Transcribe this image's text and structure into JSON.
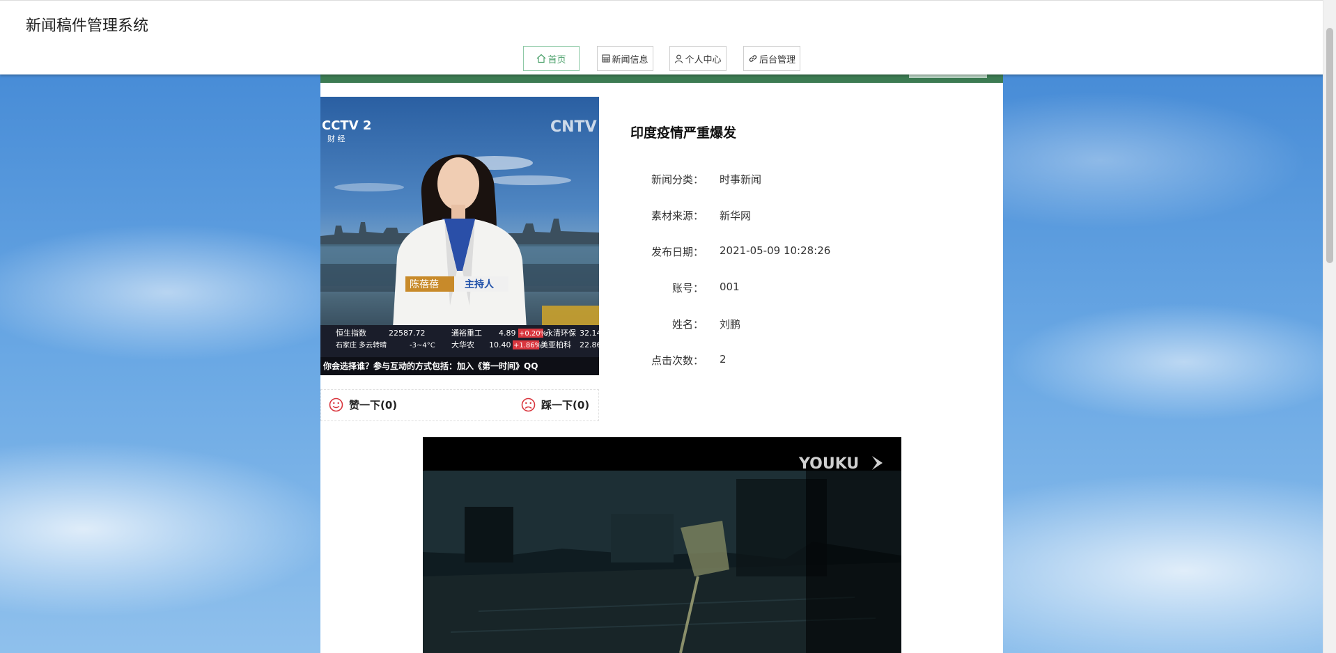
{
  "app": {
    "title": "新闻稿件管理系统"
  },
  "nav": [
    {
      "label": "首页",
      "icon": "home-icon",
      "active": true
    },
    {
      "label": "新闻信息",
      "icon": "news-grid-icon",
      "active": false
    },
    {
      "label": "个人中心",
      "icon": "user-icon",
      "active": false
    },
    {
      "label": "后台管理",
      "icon": "link-icon",
      "active": false
    }
  ],
  "article": {
    "title": "印度疫情严重爆发",
    "fields": [
      {
        "label": "新闻分类：",
        "value": "时事新闻"
      },
      {
        "label": "素材来源：",
        "value": "新华网"
      },
      {
        "label": "发布日期：",
        "value": "2021-05-09 10:28:26"
      },
      {
        "label": "账号：",
        "value": "001"
      },
      {
        "label": "姓名：",
        "value": "刘鹏"
      },
      {
        "label": "点击次数：",
        "value": "2"
      }
    ],
    "like_label": "赞一下(0)",
    "dislike_label": "踩一下(0)"
  },
  "image": {
    "channel_logo": "CCTV 2",
    "channel_sub": "财 经",
    "channel_logo_right": "CNTV",
    "anchor_name": "陈蓓蓓",
    "anchor_role": "主持人",
    "ticker_row1": [
      "恒生指数",
      "22587.72",
      "通裕重工",
      "4.89",
      "+0.20%",
      "永清环保",
      "32.14"
    ],
    "ticker_row2": [
      "石家庄 多云转晴",
      "-3~4°C",
      "大华农",
      "10.40",
      "+1.86%",
      "美亚柏科",
      "22.86"
    ],
    "ticker_row3": "你会选择谁？参与互动的方式包括：加入《第一时间》QQ"
  },
  "video": {
    "watermark": "YOUKU"
  },
  "colors": {
    "accent_green": "#3c7b52",
    "nav_active": "#4aa06a",
    "vote_red": "#d9363e"
  }
}
